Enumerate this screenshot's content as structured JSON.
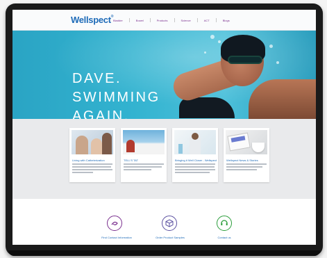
{
  "logo": {
    "text": "Wellspect",
    "tm": "®"
  },
  "nav": {
    "items": [
      "Bladder",
      "Bowel",
      "Products",
      "Science",
      "ACT",
      "Blogs"
    ]
  },
  "hero": {
    "line1": "DAVE.",
    "line2": "SWIMMING",
    "line3": "AGAIN."
  },
  "cards": [
    {
      "title": "Living with Catheterization",
      "image": "family-photo"
    },
    {
      "title": "TELL'S TAT",
      "image": "boat-photo"
    },
    {
      "title": "Bringing it Well Closer - Wellspect Healthcare",
      "image": "lab-photo"
    },
    {
      "title": "Wellspect News & Stories",
      "image": "news-photo"
    }
  ],
  "features": [
    {
      "icon": "catheter-icon",
      "label": "Find Contact Information",
      "color": "#7a2f8e"
    },
    {
      "icon": "cube-icon",
      "label": "Order Product Samples",
      "color": "#5a4fa0"
    },
    {
      "icon": "phone-icon",
      "label": "Contact us",
      "color": "#2a9d3a"
    }
  ],
  "colors": {
    "brand": "#1e6bb8",
    "accent": "#7a2f8e",
    "hero": "#2aa4c4"
  }
}
